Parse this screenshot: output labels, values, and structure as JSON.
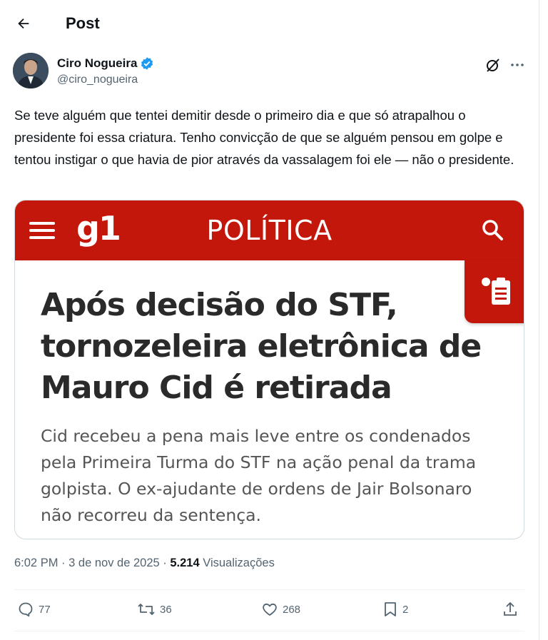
{
  "header": {
    "title": "Post"
  },
  "author": {
    "name": "Ciro Nogueira",
    "handle": "@ciro_nogueira",
    "verified_color": "#1d9bf0"
  },
  "tweet": {
    "text": "Se teve alguém que tentei demitir desde o primeiro dia e que só atrapalhou o presidente foi essa criatura. Tenho convicção de que se alguém pensou em golpe e tentou instigar o que havia de pior através da vassalagem foi ele — não o presidente."
  },
  "card": {
    "logo": "g1",
    "section": "POLÍTICA",
    "headline": "Após decisão do STF, tornozeleira eletrônica de Mauro Cid é retirada",
    "subhead": "Cid recebeu a pena mais leve entre os condenados pela Primeira Turma do STF na ação penal da trama golpista. O ex-ajudante de ordens de Jair Bolsonaro não recorreu da sentença.",
    "brand_color": "#c4170c"
  },
  "meta": {
    "time": "6:02 PM",
    "date": "3 de nov de 2025",
    "views_count": "5.214",
    "views_label": "Visualizações"
  },
  "actions": {
    "replies": "77",
    "reposts": "36",
    "likes": "268",
    "bookmarks": "2"
  },
  "icons": [
    "back-arrow-icon",
    "verified-badge-icon",
    "grok-icon",
    "more-icon",
    "menu-icon",
    "search-icon",
    "clipboard-icon",
    "reply-icon",
    "repost-icon",
    "like-icon",
    "bookmark-icon",
    "share-icon"
  ]
}
